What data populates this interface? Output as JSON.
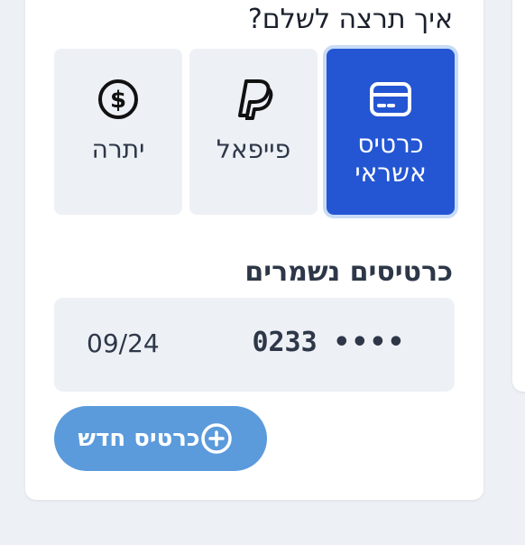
{
  "payment": {
    "question": "איך תרצה לשלם?",
    "methods": [
      {
        "label": "כרטיס אשראי",
        "icon": "credit-card-icon",
        "selected": true
      },
      {
        "label": "פייפאל",
        "icon": "paypal-icon",
        "selected": false
      },
      {
        "label": "יתרה",
        "icon": "dollar-coin-icon",
        "selected": false
      }
    ]
  },
  "saved_cards": {
    "heading": "כרטיסים נשמרים",
    "cards": [
      {
        "masked": "••••",
        "last4": "0233",
        "expiry": "09/24"
      }
    ]
  },
  "new_card_button": {
    "label": "כרטיס חדש",
    "icon": "plus-circle-icon"
  },
  "colors": {
    "accent": "#2456d3",
    "button": "#5b9bdc",
    "tile_background": "#edf0f5"
  }
}
